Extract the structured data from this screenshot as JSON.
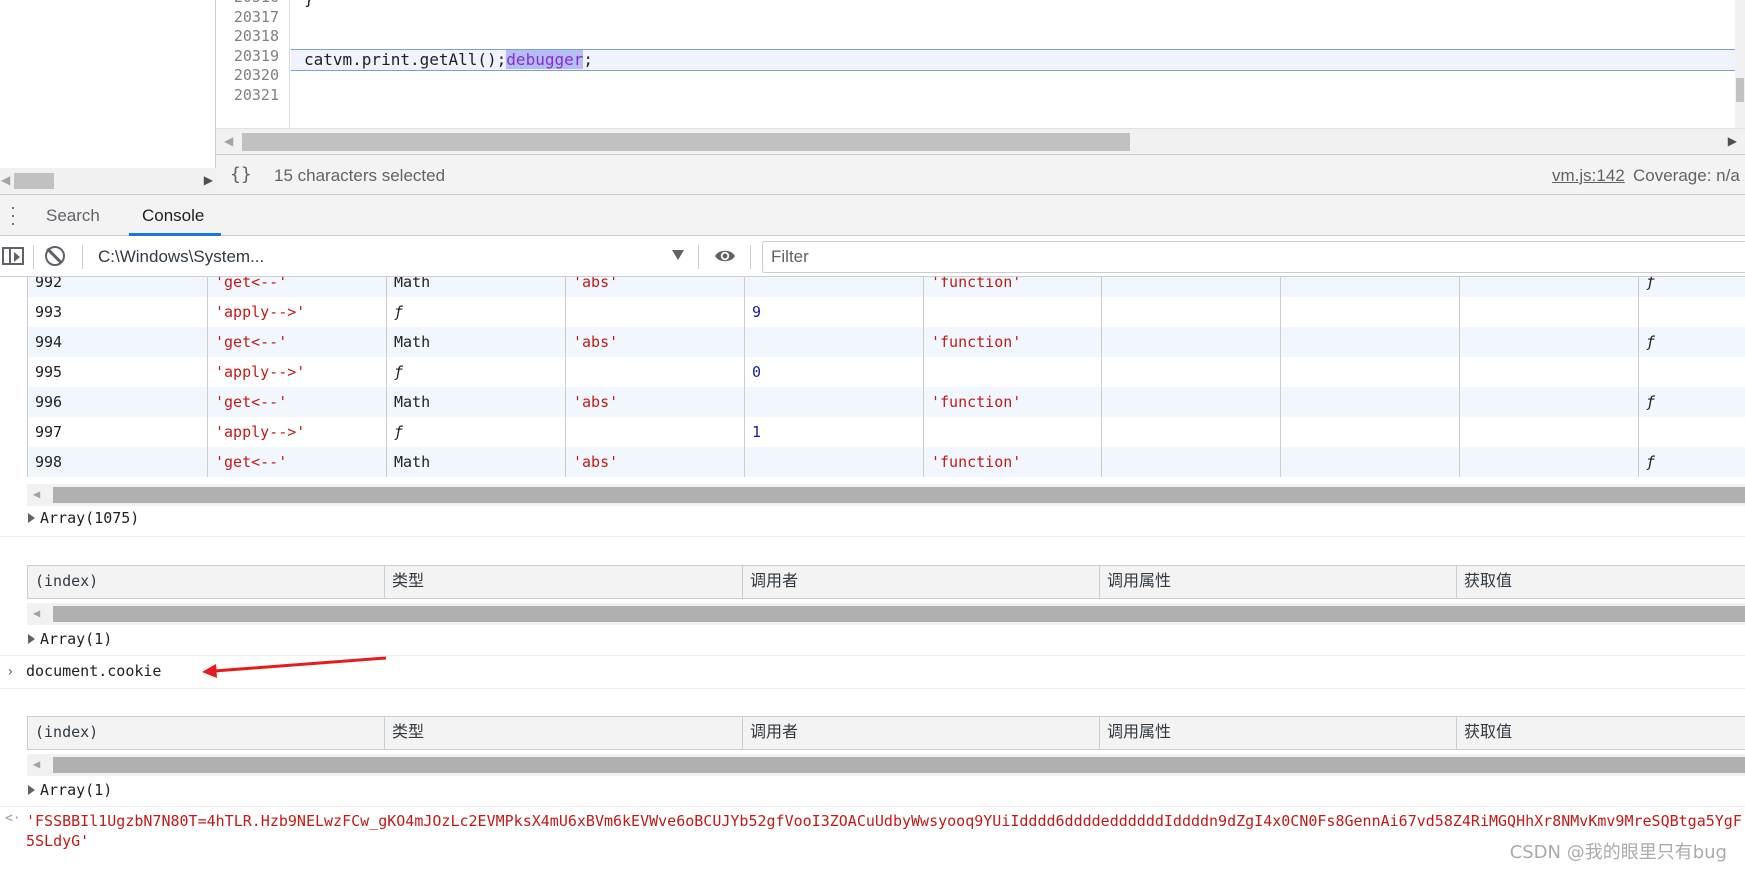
{
  "editor": {
    "line_numbers": [
      "20317",
      "20318",
      "20319",
      "20320",
      "20321"
    ],
    "partial_top_char": "}",
    "active_line_code": "catvm.print.getAll();",
    "active_line_selected": "debugger",
    "active_line_tail": ";"
  },
  "status_bar": {
    "pretty_print_icon": "{}",
    "selection_status": "15 characters selected",
    "file_link": "vm.js:142",
    "coverage": "Coverage: n/a"
  },
  "drawer": {
    "tabs": [
      {
        "label": "Search"
      },
      {
        "label": "Console",
        "active": true
      }
    ]
  },
  "console_toolbar": {
    "context": "C:\\Windows\\System...",
    "filter_placeholder": "Filter"
  },
  "table1": {
    "rows": [
      {
        "index": "992",
        "c1": "'get<--'",
        "c2": "Math",
        "c3": "'abs'",
        "c4": "",
        "c5": "'function'",
        "last": "ƒ"
      },
      {
        "index": "993",
        "c1": "'apply-->'",
        "c2": "ƒ",
        "c3": "",
        "c4": "9",
        "c5": "",
        "last": ""
      },
      {
        "index": "994",
        "c1": "'get<--'",
        "c2": "Math",
        "c3": "'abs'",
        "c4": "",
        "c5": "'function'",
        "last": "ƒ"
      },
      {
        "index": "995",
        "c1": "'apply-->'",
        "c2": "ƒ",
        "c3": "",
        "c4": "0",
        "c5": "",
        "last": ""
      },
      {
        "index": "996",
        "c1": "'get<--'",
        "c2": "Math",
        "c3": "'abs'",
        "c4": "",
        "c5": "'function'",
        "last": "ƒ"
      },
      {
        "index": "997",
        "c1": "'apply-->'",
        "c2": "ƒ",
        "c3": "",
        "c4": "1",
        "c5": "",
        "last": ""
      },
      {
        "index": "998",
        "c1": "'get<--'",
        "c2": "Math",
        "c3": "'abs'",
        "c4": "",
        "c5": "'function'",
        "last": "ƒ"
      }
    ]
  },
  "array_labels": {
    "first": "Array(1075)",
    "second": "Array(1)",
    "third": "Array(1)"
  },
  "table_header": {
    "index": "(index)",
    "type": "类型",
    "caller": "调用者",
    "call_property": "调用属性",
    "get_value": "获取值"
  },
  "console_input": "document.cookie",
  "cookie_result": "'FSSBBIl1UgzbN7N80T=4hTLR.Hzb9NELwzFCw_gKO4mJOzLc2EVMPksX4mU6xBVm6kEVWve6oBCUJYb52gfVooI3ZOACuUdbyWwsyooq9YUiIdddd6ddddeddddddIddddn9dZgI4x0CN0Fs8GennAi67vd58Z4RiMGQHhXr8NMvKmv9MreSQBtga5YgF5SLdyG'",
  "colors": {
    "string": "#c41a16",
    "number": "#1a1aa6",
    "selection": "#b5bdf6",
    "annotation_arrow": "#e81b1b",
    "active_tab": "#1a73e8"
  },
  "watermark": "CSDN @我的眼里只有bug"
}
